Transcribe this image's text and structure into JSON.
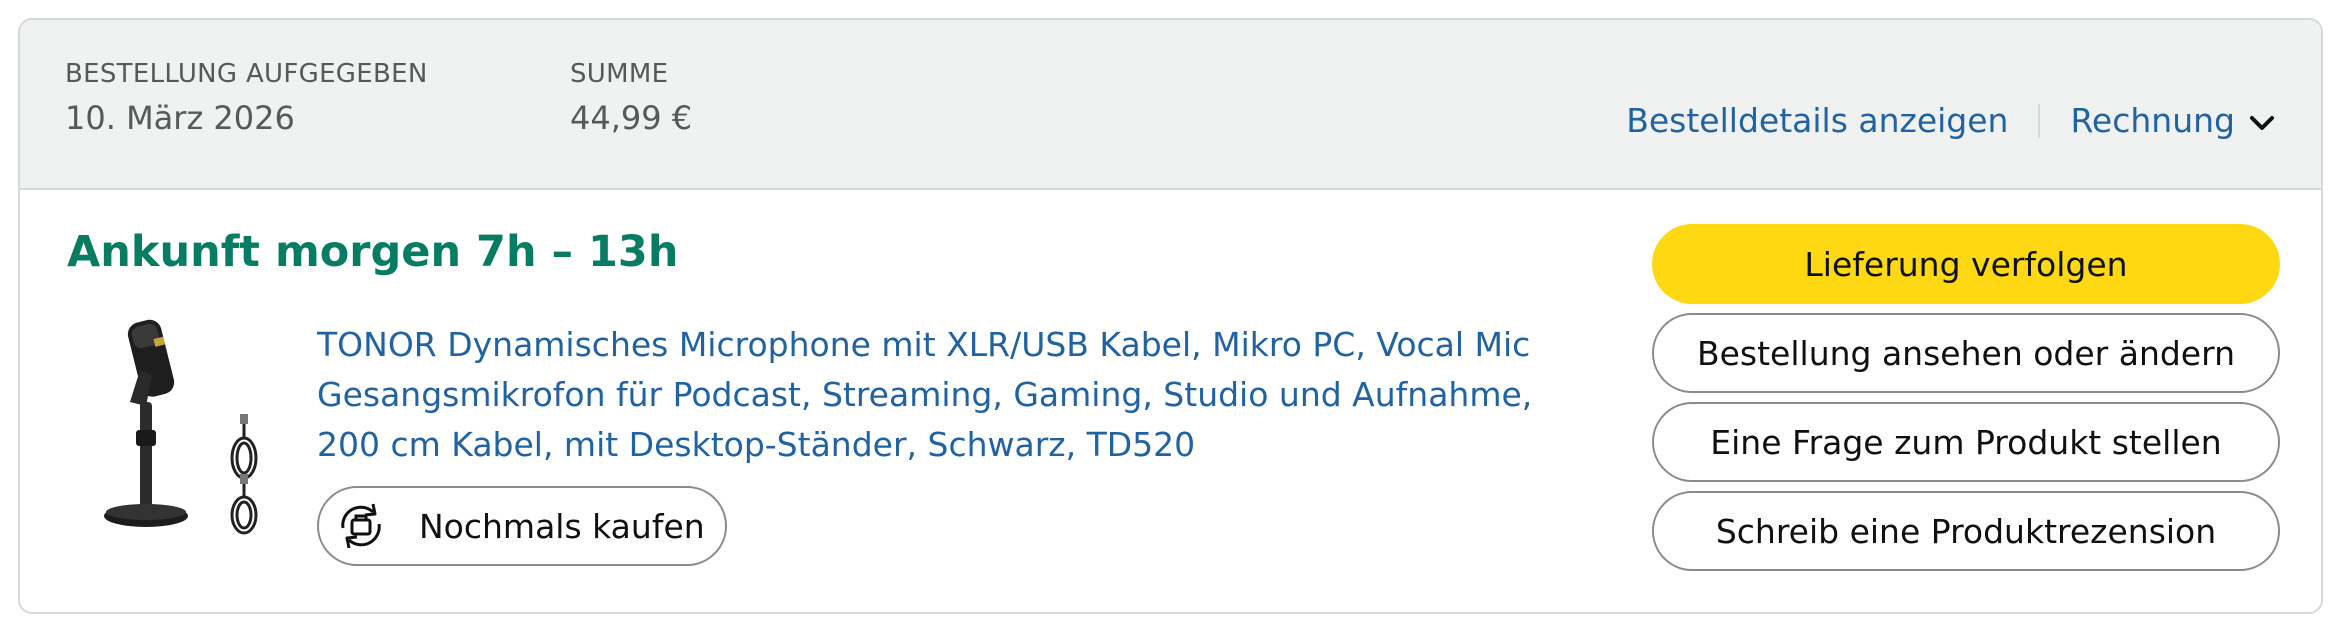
{
  "header": {
    "order_placed_label": "BESTELLUNG AUFGEGEBEN",
    "order_date": "10. März 2026",
    "total_label": "SUMME",
    "total_value": "44,99 €",
    "details_link": "Bestelldetails anzeigen",
    "invoice_link": "Rechnung"
  },
  "shipment": {
    "status": "Ankunft morgen 7h – 13h"
  },
  "product": {
    "title": "TONOR Dynamisches Microphone mit XLR/USB Kabel, Mikro PC, Vocal Mic Gesangsmikrofon für Podcast, Streaming, Gaming, Studio und Aufnahme, 200 cm Kabel, mit Desktop-Ständer, Schwarz, TD520",
    "rebuy_label": "Nochmals kaufen"
  },
  "actions": {
    "track": "Lieferung verfolgen",
    "view_edit": "Bestellung ansehen oder ändern",
    "question": "Eine Frage zum Produkt stellen",
    "review": "Schreib eine Produktrezension"
  },
  "colors": {
    "primary_button": "#ffd814",
    "link": "#2162a1",
    "arrival": "#067d62",
    "header_bg": "#f0f2f2"
  },
  "icons": {
    "invoice_dropdown": "chevron-down-icon",
    "rebuy": "rebuy-cart-icon"
  }
}
